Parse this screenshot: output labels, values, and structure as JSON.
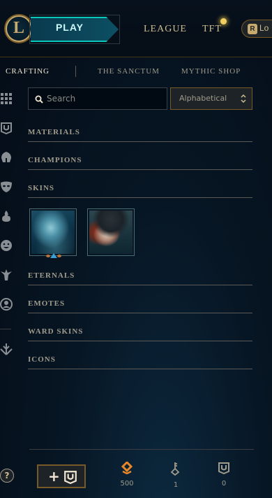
{
  "topbar": {
    "logo_letter": "L",
    "play_label": "PLAY",
    "nav": {
      "league": "LEAGUE",
      "tft": "TFT"
    },
    "loot_pill": {
      "icon_letter": "R",
      "label": "Lo"
    }
  },
  "subnav": {
    "tabs": [
      {
        "label": "CRAFTING",
        "active": true
      },
      {
        "label": "THE SANCTUM",
        "active": false
      },
      {
        "label": "MYTHIC SHOP",
        "active": false
      }
    ]
  },
  "rail": {
    "icons": [
      "grid-icon",
      "chest-icon",
      "champion-helmet-icon",
      "skin-mask-icon",
      "ward-flame-icon",
      "emote-face-icon",
      "totem-icon",
      "profile-icon",
      "eternals-arrow-icon"
    ]
  },
  "search": {
    "placeholder": "Search",
    "value": ""
  },
  "sort": {
    "selected": "Alphabetical"
  },
  "categories": [
    {
      "label": "MATERIALS"
    },
    {
      "label": "CHAMPIONS"
    },
    {
      "label": "SKINS"
    },
    {
      "label": "ETERNALS"
    },
    {
      "label": "EMOTES"
    },
    {
      "label": "WARD SKINS"
    },
    {
      "label": "ICONS"
    }
  ],
  "skins": {
    "items": [
      "skin-tile-1",
      "skin-tile-2"
    ]
  },
  "footer": {
    "help_label": "?",
    "add_chest_label": "+",
    "currencies": {
      "essence": "500",
      "keys": "1",
      "chests": "0"
    }
  },
  "colors": {
    "gold": "#c8aa6e",
    "teal": "#0ac8b9",
    "text": "#a09b8c",
    "background": "#071624"
  }
}
